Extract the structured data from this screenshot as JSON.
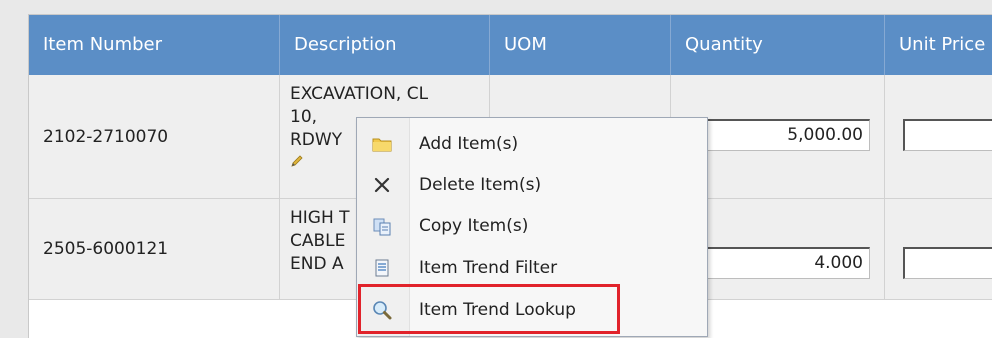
{
  "grid": {
    "columns": [
      "Item Number",
      "Description",
      "UOM",
      "Quantity",
      "Unit Price"
    ],
    "rows": [
      {
        "item_number": "2102-2710070",
        "description": [
          "EXCAVATION, CL",
          "10,",
          "RDWY"
        ],
        "uom": "",
        "quantity": "5,000.00",
        "unit_price": ""
      },
      {
        "item_number": "2505-6000121",
        "description": [
          "HIGH T",
          "CABLE",
          "END A"
        ],
        "uom": "",
        "quantity": "4.000",
        "unit_price": "$"
      }
    ]
  },
  "context_menu": {
    "items": [
      {
        "label": "Add Item(s)",
        "icon": "folder-icon"
      },
      {
        "label": "Delete Item(s)",
        "icon": "close-x-icon"
      },
      {
        "label": "Copy Item(s)",
        "icon": "copy-icon"
      },
      {
        "label": "Item Trend Filter",
        "icon": "document-filter-icon"
      },
      {
        "label": "Item Trend Lookup",
        "icon": "magnifier-icon"
      }
    ],
    "highlighted_item": "Item Trend Lookup"
  },
  "colors": {
    "header_bg": "#5b8ec6",
    "highlight_border": "#e1232b"
  }
}
